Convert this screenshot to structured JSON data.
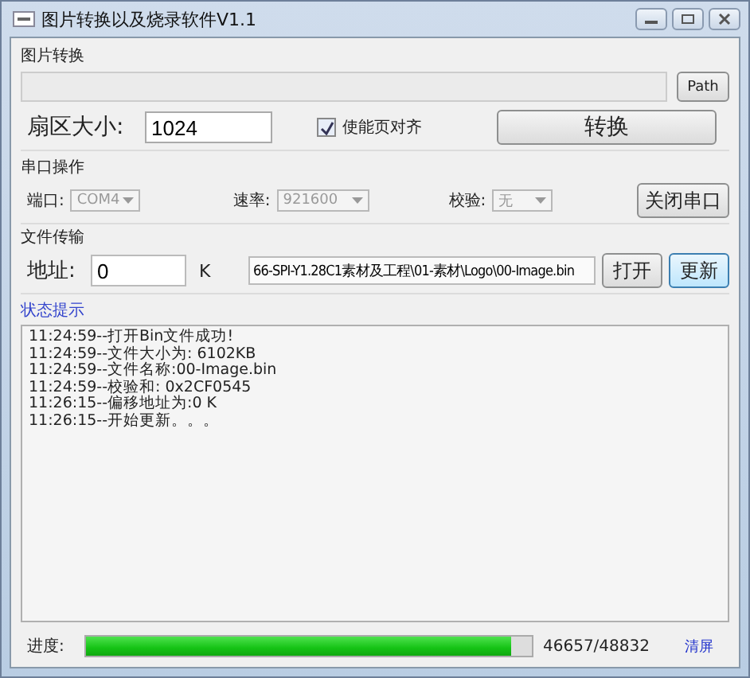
{
  "window": {
    "title": "图片转换以及烧录软件V1.1"
  },
  "image_convert": {
    "title": "图片转换",
    "path_button": "Path",
    "sector_label": "扇区大小:",
    "sector_value": "1024",
    "align_checkbox": {
      "label": "使能页对齐",
      "checked": true
    },
    "convert_button": "转换"
  },
  "serial": {
    "title": "串口操作",
    "fields": [
      {
        "label": "端口:",
        "value": "COM4",
        "disabled": true
      },
      {
        "label": "速率:",
        "value": "921600",
        "disabled": true
      },
      {
        "label": "校验:",
        "value": "无",
        "disabled": true
      }
    ],
    "close_button": "关闭串口"
  },
  "file_transfer": {
    "title": "文件传输",
    "address_label": "地址:",
    "address_value": "0",
    "unit": "K",
    "file_path": "66-SPI-Y1.28C1素材及工程\\01-素材\\Logo\\00-Image.bin",
    "open_button": "打开",
    "update_button": "更新"
  },
  "status": {
    "title": "状态提示",
    "lines": [
      "11:24:59--打开Bin文件成功!",
      "11:24:59--文件大小为: 6102KB",
      "11:24:59--文件名称:00-Image.bin",
      "11:24:59--校验和: 0x2CF0545",
      "11:26:15--偏移地址为:0  K",
      "11:26:15--开始更新。。。"
    ]
  },
  "progress": {
    "label": "进度:",
    "level": 0.955,
    "reading": "46657/48832",
    "clear_link": "清屏"
  }
}
